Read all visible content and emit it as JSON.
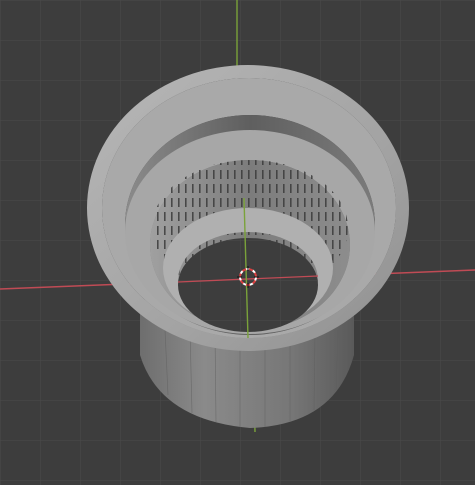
{
  "viewport": {
    "view": "3d-viewport",
    "background_color": "#3d3d3d",
    "grid_color": "#4a4a4a",
    "x_axis_color": "#c04b55",
    "y_axis_color": "#7aa23a"
  },
  "scene": {
    "object": "cylinder-sleeve-mesh",
    "object_color": "#9d9d9d",
    "cursor_icon": "3d-cursor-icon",
    "perforation_pattern": "vertical-slots"
  }
}
